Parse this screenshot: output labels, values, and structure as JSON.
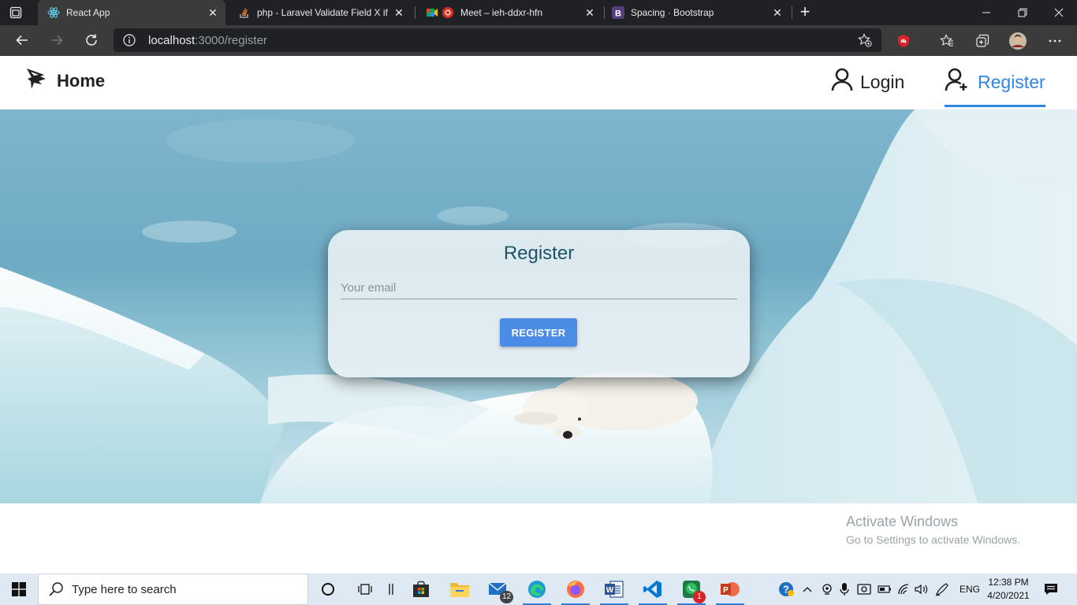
{
  "browser": {
    "tabs": [
      {
        "title": "React App",
        "icon": "react-icon",
        "active": true
      },
      {
        "title": "php - Laravel Validate Field X if F",
        "icon": "stackoverflow-icon",
        "active": false
      },
      {
        "title": "Meet – ieh-ddxr-hfn",
        "icon": "meet-icon",
        "active": false
      },
      {
        "title": "Spacing · Bootstrap",
        "icon": "bootstrap-icon",
        "active": false
      }
    ],
    "url_host": "localhost",
    "url_path": ":3000/register"
  },
  "nav": {
    "home_label": "Home",
    "login_label": "Login",
    "register_label": "Register",
    "accent_color": "#2e86e6"
  },
  "card": {
    "title": "Register",
    "email_placeholder": "Your email",
    "email_value": "",
    "button_label": "REGISTER"
  },
  "watermark": {
    "line1": "Activate Windows",
    "line2": "Go to Settings to activate Windows."
  },
  "taskbar": {
    "search_placeholder": "Type here to search",
    "mail_badge": "12",
    "whatsapp_badge": "1",
    "language": "ENG",
    "time": "12:38 PM",
    "date": "4/20/2021"
  }
}
